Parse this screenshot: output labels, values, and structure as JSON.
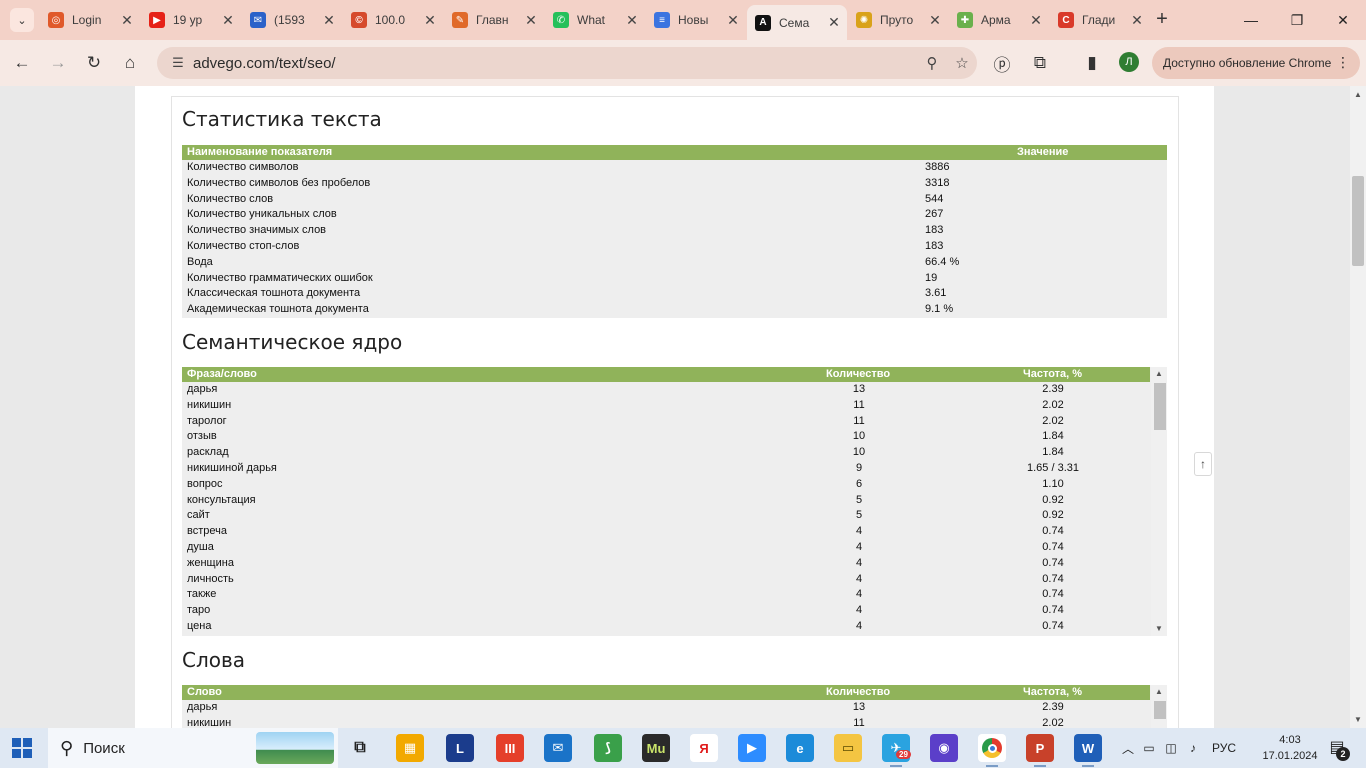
{
  "browser": {
    "tabs": [
      {
        "title": "Login",
        "color": "#e0592a",
        "glyph": "◎"
      },
      {
        "title": "19 ур",
        "color": "#e62117",
        "glyph": "▶"
      },
      {
        "title": "(1593",
        "color": "#2b62c9",
        "glyph": "✉"
      },
      {
        "title": "100.0",
        "color": "#d64a2c",
        "glyph": "©"
      },
      {
        "title": "Главн",
        "color": "#e06a2a",
        "glyph": "✎"
      },
      {
        "title": "What",
        "color": "#25c05a",
        "glyph": "✆"
      },
      {
        "title": "Новы",
        "color": "#3b74e0",
        "glyph": "≡"
      },
      {
        "title": "Сема",
        "color": "#111111",
        "glyph": "A",
        "active": true
      },
      {
        "title": "Пруто",
        "color": "#d9a21a",
        "glyph": "✺"
      },
      {
        "title": "Арма",
        "color": "#6ab04c",
        "glyph": "✚"
      },
      {
        "title": "Глади",
        "color": "#d93a2a",
        "glyph": "C"
      }
    ],
    "url": "advego.com/text/seo/",
    "update_label": "Доступно обновление Chrome",
    "profile_initial": "Л"
  },
  "page": {
    "stats_title": "Статистика текста",
    "stats_headers": {
      "name": "Наименование показателя",
      "value": "Значение"
    },
    "stats": [
      {
        "name": "Количество символов",
        "value": "3886"
      },
      {
        "name": "Количество символов без пробелов",
        "value": "3318"
      },
      {
        "name": "Количество слов",
        "value": "544"
      },
      {
        "name": "Количество уникальных слов",
        "value": "267"
      },
      {
        "name": "Количество значимых слов",
        "value": "183"
      },
      {
        "name": "Количество стоп-слов",
        "value": "183"
      },
      {
        "name": "Вода",
        "value": "66.4 %"
      },
      {
        "name": "Количество грамматических ошибок",
        "value": "19"
      },
      {
        "name": "Классическая тошнота документа",
        "value": "3.61"
      },
      {
        "name": "Академическая тошнота документа",
        "value": "9.1 %"
      }
    ],
    "semcore_title": "Семантическое ядро",
    "semcore_headers": {
      "phrase": "Фраза/слово",
      "count": "Количество",
      "freq": "Частота, %"
    },
    "semcore": [
      {
        "phrase": "дарья",
        "count": "13",
        "freq": "2.39"
      },
      {
        "phrase": "никишин",
        "count": "11",
        "freq": "2.02"
      },
      {
        "phrase": "таролог",
        "count": "11",
        "freq": "2.02"
      },
      {
        "phrase": "отзыв",
        "count": "10",
        "freq": "1.84"
      },
      {
        "phrase": "расклад",
        "count": "10",
        "freq": "1.84"
      },
      {
        "phrase": "никишиной дарья",
        "count": "9",
        "freq": "1.65 / 3.31"
      },
      {
        "phrase": "вопрос",
        "count": "6",
        "freq": "1.10"
      },
      {
        "phrase": "консультация",
        "count": "5",
        "freq": "0.92"
      },
      {
        "phrase": "сайт",
        "count": "5",
        "freq": "0.92"
      },
      {
        "phrase": "встреча",
        "count": "4",
        "freq": "0.74"
      },
      {
        "phrase": "душа",
        "count": "4",
        "freq": "0.74"
      },
      {
        "phrase": "женщина",
        "count": "4",
        "freq": "0.74"
      },
      {
        "phrase": "личность",
        "count": "4",
        "freq": "0.74"
      },
      {
        "phrase": "также",
        "count": "4",
        "freq": "0.74"
      },
      {
        "phrase": "таро",
        "count": "4",
        "freq": "0.74"
      },
      {
        "phrase": "цена",
        "count": "4",
        "freq": "0.74"
      }
    ],
    "words_title": "Слова",
    "words_headers": {
      "word": "Слово",
      "count": "Количество",
      "freq": "Частота, %"
    },
    "words": [
      {
        "word": "дарья",
        "count": "13",
        "freq": "2.39"
      },
      {
        "word": "никишин",
        "count": "11",
        "freq": "2.02"
      }
    ]
  },
  "taskbar": {
    "search_label": "Поиск",
    "lang": "РУС",
    "time": "4:03",
    "date": "17.01.2024",
    "notifications": "2",
    "telegram_badge": "29"
  }
}
